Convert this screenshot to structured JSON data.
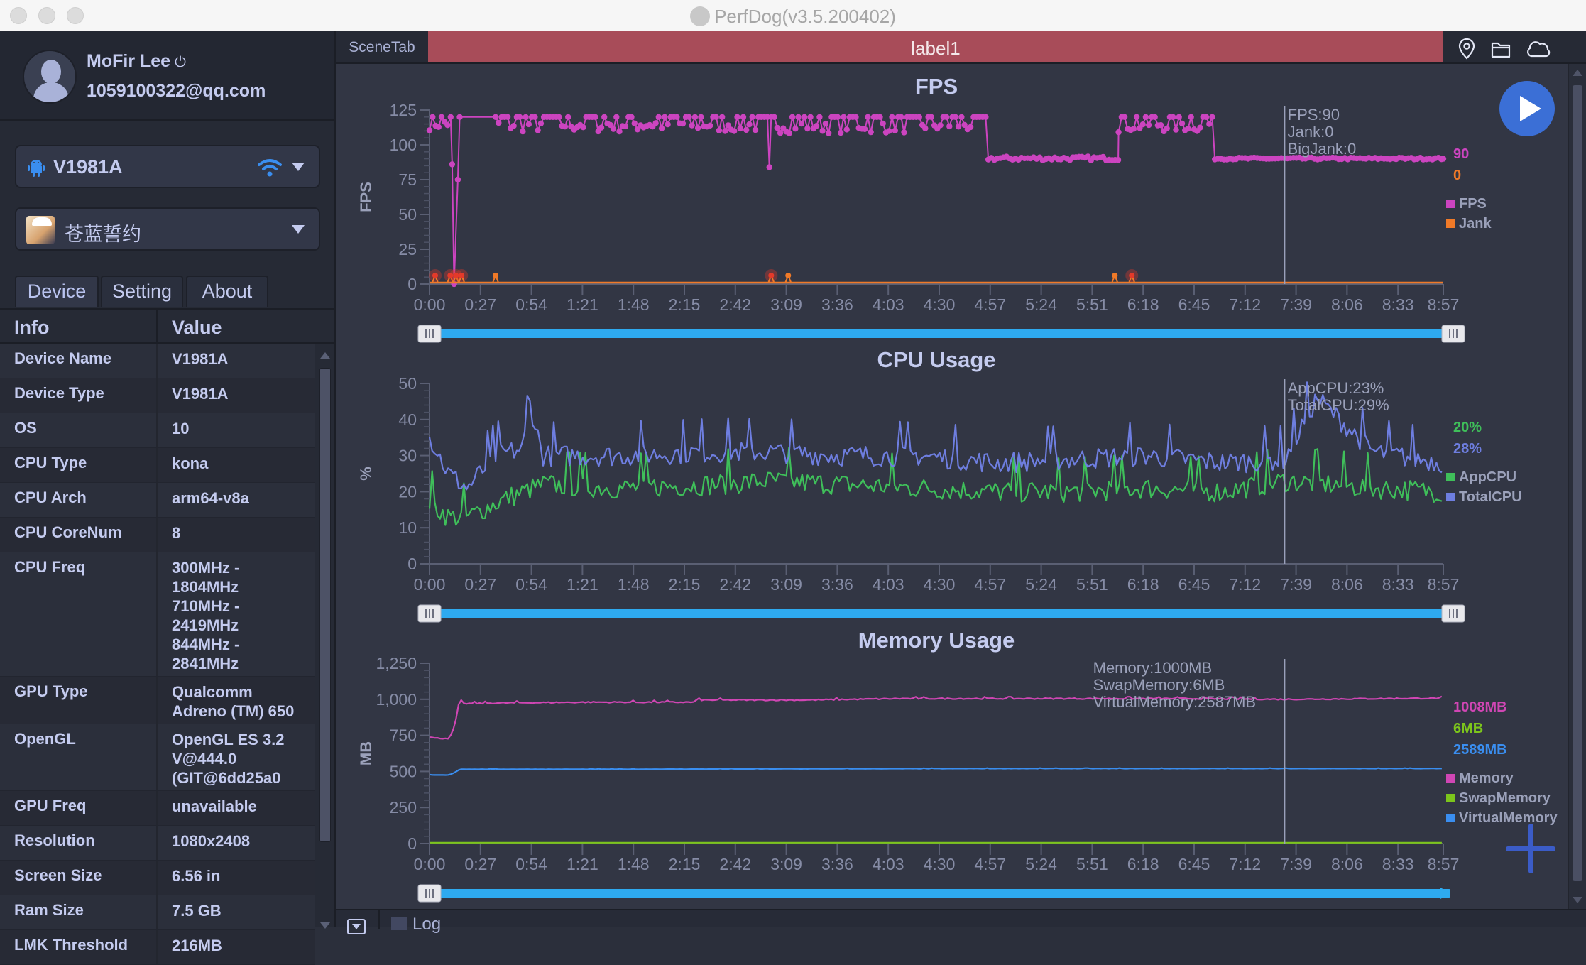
{
  "window": {
    "title": "PerfDog(v3.5.200402)"
  },
  "user": {
    "name": "MoFir Lee",
    "email": "1059100322@qq.com",
    "power_icon": "power-icon"
  },
  "device_select": {
    "value": "V1981A",
    "icon": "android-icon",
    "connection_icon": "wifi-icon"
  },
  "app_select": {
    "value": "苍蓝誓约",
    "icon": "game-app-icon"
  },
  "sidebar_tabs": [
    {
      "label": "Device",
      "active": true
    },
    {
      "label": "Setting",
      "active": false
    },
    {
      "label": "About",
      "active": false
    }
  ],
  "info_table": {
    "headers": [
      "Info",
      "Value"
    ],
    "rows": [
      {
        "key": "Device Name",
        "value": "V1981A"
      },
      {
        "key": "Device Type",
        "value": "V1981A"
      },
      {
        "key": "OS",
        "value": "10"
      },
      {
        "key": "CPU Type",
        "value": "kona"
      },
      {
        "key": "CPU Arch",
        "value": "arm64-v8a"
      },
      {
        "key": "CPU CoreNum",
        "value": "8"
      },
      {
        "key": "CPU Freq",
        "value": "300MHz -\n1804MHz\n710MHz -\n2419MHz\n844MHz -\n2841MHz"
      },
      {
        "key": "GPU Type",
        "value": "Qualcomm\nAdreno (TM) 650"
      },
      {
        "key": "OpenGL",
        "value": "OpenGL ES 3.2\nV@444.0\n(GIT@6dd25a0"
      },
      {
        "key": "GPU Freq",
        "value": "unavailable"
      },
      {
        "key": "Resolution",
        "value": "1080x2408"
      },
      {
        "key": "Screen Size",
        "value": "6.56 in"
      },
      {
        "key": "Ram Size",
        "value": "7.5 GB"
      },
      {
        "key": "LMK Threshold",
        "value": "216MB"
      }
    ]
  },
  "scene": {
    "tab_label": "SceneTab",
    "label": "label1",
    "label_color": "#a84c59"
  },
  "toolbar_icons": [
    "location-pin-icon",
    "folder-icon",
    "cloud-icon"
  ],
  "log": {
    "label": "Log"
  },
  "colors": {
    "fps": "#cc44c0",
    "jank": "#f07a28",
    "bigjank": "#e43a2a",
    "app_cpu": "#3fbf5a",
    "total_cpu": "#6e7ee0",
    "memory": "#d046b4",
    "swap": "#7cc51c",
    "virtual": "#3a8ef0",
    "slider": "#2eaaf0"
  },
  "chart_data": [
    {
      "type": "line",
      "title": "FPS",
      "ylabel": "FPS",
      "xlabel": "",
      "ylim": [
        0,
        125
      ],
      "yticks": [
        "0",
        "25",
        "50",
        "75",
        "100",
        "125"
      ],
      "xticks": [
        "0:00",
        "0:27",
        "0:54",
        "1:21",
        "1:48",
        "2:15",
        "2:42",
        "3:09",
        "3:36",
        "4:03",
        "4:30",
        "4:57",
        "5:24",
        "5:51",
        "6:18",
        "6:45",
        "7:12",
        "7:39",
        "8:06",
        "8:33",
        "8:57"
      ],
      "duration_s": 537,
      "cursor_time_s": 453,
      "cursor_readout": [
        "FPS:90",
        "Jank:0",
        "BigJank:0"
      ],
      "last_values": [
        {
          "text": "90",
          "series": "FPS"
        },
        {
          "text": "0",
          "series": "Jank"
        }
      ],
      "legend": [
        "FPS",
        "Jank"
      ],
      "series": [
        {
          "name": "FPS",
          "segments": [
            {
              "t0": 0,
              "t1": 12,
              "level": 115,
              "noise": 8
            },
            {
              "t0": 12,
              "t1": 13,
              "level": 86,
              "noise": 0
            },
            {
              "t0": 13,
              "t1": 15,
              "level": 0,
              "noise": 0
            },
            {
              "t0": 15,
              "t1": 16,
              "level": 75,
              "noise": 0
            },
            {
              "t0": 16,
              "t1": 35,
              "level": 120,
              "noise": 0
            },
            {
              "t0": 35,
              "t1": 180,
              "level": 114,
              "noise": 9
            },
            {
              "t0": 180,
              "t1": 181,
              "level": 84,
              "noise": 0
            },
            {
              "t0": 181,
              "t1": 296,
              "level": 114,
              "noise": 10
            },
            {
              "t0": 296,
              "t1": 365,
              "level": 90,
              "noise": 2
            },
            {
              "t0": 365,
              "t1": 416,
              "level": 114,
              "noise": 9
            },
            {
              "t0": 416,
              "t1": 537,
              "level": 90,
              "noise": 1
            }
          ]
        },
        {
          "name": "Jank",
          "spikes_s": [
            3,
            11,
            14,
            17,
            35,
            181,
            190,
            363,
            372
          ],
          "bigjank_s": [
            3,
            11,
            14,
            17,
            181,
            372
          ],
          "level": 0
        }
      ]
    },
    {
      "type": "line",
      "title": "CPU Usage",
      "ylabel": "%",
      "xlabel": "",
      "ylim": [
        0,
        50
      ],
      "yticks": [
        "0",
        "10",
        "20",
        "30",
        "40",
        "50"
      ],
      "xticks": [
        "0:00",
        "0:27",
        "0:54",
        "1:21",
        "1:48",
        "2:15",
        "2:42",
        "3:09",
        "3:36",
        "4:03",
        "4:30",
        "4:57",
        "5:24",
        "5:51",
        "6:18",
        "6:45",
        "7:12",
        "7:39",
        "8:06",
        "8:33",
        "8:57"
      ],
      "duration_s": 537,
      "cursor_time_s": 453,
      "cursor_readout": [
        "AppCPU:23%",
        "TotalCPU:29%"
      ],
      "last_values": [
        {
          "text": "20%",
          "series": "AppCPU"
        },
        {
          "text": "28%",
          "series": "TotalCPU"
        }
      ],
      "legend": [
        "AppCPU",
        "TotalCPU"
      ],
      "series": [
        {
          "name": "AppCPU",
          "anchors": [
            [
              0,
              17
            ],
            [
              10,
              13
            ],
            [
              20,
              13
            ],
            [
              40,
              18
            ],
            [
              60,
              22
            ],
            [
              100,
              21
            ],
            [
              150,
              22
            ],
            [
              180,
              23
            ],
            [
              220,
              22
            ],
            [
              260,
              21
            ],
            [
              300,
              20
            ],
            [
              340,
              20
            ],
            [
              380,
              21
            ],
            [
              420,
              20
            ],
            [
              453,
              23
            ],
            [
              500,
              21
            ],
            [
              537,
              20
            ]
          ],
          "noise": 3
        },
        {
          "name": "TotalCPU",
          "anchors": [
            [
              0,
              35
            ],
            [
              10,
              25
            ],
            [
              20,
              21
            ],
            [
              35,
              30
            ],
            [
              50,
              32
            ],
            [
              52,
              47
            ],
            [
              60,
              30
            ],
            [
              100,
              30
            ],
            [
              150,
              31
            ],
            [
              180,
              31
            ],
            [
              220,
              30
            ],
            [
              260,
              30
            ],
            [
              300,
              28
            ],
            [
              340,
              29
            ],
            [
              380,
              30
            ],
            [
              420,
              28
            ],
            [
              453,
              29
            ],
            [
              470,
              46
            ],
            [
              500,
              31
            ],
            [
              537,
              28
            ]
          ],
          "noise": 3
        }
      ]
    },
    {
      "type": "line",
      "title": "Memory Usage",
      "ylabel": "MB",
      "xlabel": "",
      "ylim": [
        0,
        1250
      ],
      "yticks": [
        "0",
        "250",
        "500",
        "750",
        "1,000",
        "1,250"
      ],
      "xticks": [
        "0:00",
        "0:27",
        "0:54",
        "1:21",
        "1:48",
        "2:15",
        "2:42",
        "3:09",
        "3:36",
        "4:03",
        "4:30",
        "4:57",
        "5:24",
        "5:51",
        "6:18",
        "6:45",
        "7:12",
        "7:39",
        "8:06",
        "8:33",
        "8:57"
      ],
      "duration_s": 537,
      "cursor_time_s": 453,
      "cursor_readout": [
        "Memory:1000MB",
        "SwapMemory:6MB",
        "VirtualMemory:2587MB"
      ],
      "last_values": [
        {
          "text": "1008MB",
          "series": "Memory"
        },
        {
          "text": "6MB",
          "series": "SwapMemory"
        },
        {
          "text": "2589MB",
          "series": "VirtualMemory"
        }
      ],
      "legend": [
        "Memory",
        "SwapMemory",
        "VirtualMemory"
      ],
      "series": [
        {
          "name": "Memory",
          "anchors": [
            [
              0,
              740
            ],
            [
              3,
              730
            ],
            [
              10,
              730
            ],
            [
              12,
              760
            ],
            [
              14,
              860
            ],
            [
              16,
              990
            ],
            [
              18,
              970
            ],
            [
              40,
              975
            ],
            [
              80,
              980
            ],
            [
              140,
              980
            ],
            [
              141,
              995
            ],
            [
              200,
              995
            ],
            [
              250,
              1005
            ],
            [
              300,
              1005
            ],
            [
              400,
              1005
            ],
            [
              453,
              1000
            ],
            [
              537,
              1008
            ]
          ],
          "noise": 4
        },
        {
          "name": "SwapMemory",
          "anchors": [
            [
              0,
              6
            ],
            [
              537,
              6
            ]
          ],
          "noise": 0
        },
        {
          "name": "VirtualMemory",
          "anchors": [
            [
              0,
              475
            ],
            [
              10,
              475
            ],
            [
              13,
              490
            ],
            [
              16,
              515
            ],
            [
              100,
              515
            ],
            [
              200,
              518
            ],
            [
              300,
              520
            ],
            [
              400,
              520
            ],
            [
              537,
              520
            ]
          ],
          "noise": 1
        }
      ],
      "note": "VirtualMemory line drawn on display scale (~520) while readout shows 2589MB"
    }
  ]
}
